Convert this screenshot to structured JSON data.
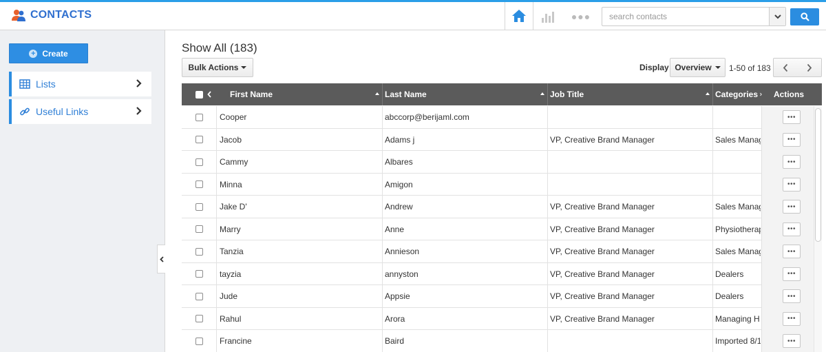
{
  "app": {
    "title": "CONTACTS"
  },
  "search": {
    "placeholder": "search contacts"
  },
  "sidebar": {
    "create_label": "Create",
    "items": [
      {
        "label": "Lists",
        "icon": "table-icon"
      },
      {
        "label": "Useful Links",
        "icon": "link-icon"
      }
    ]
  },
  "main": {
    "title": "Show All (183)",
    "bulk_actions_label": "Bulk Actions",
    "display_label": "Display",
    "display_value": "Overview",
    "page_range": "1-50 of 183"
  },
  "table": {
    "columns": [
      "First Name",
      "Last Name",
      "Job Title",
      "Categories",
      "Actions"
    ],
    "rows": [
      {
        "first": "Cooper",
        "last": "abccorp@berijaml.com",
        "job": "",
        "category": ""
      },
      {
        "first": "Jacob",
        "last": "Adams j",
        "job": "VP, Creative Brand Manager",
        "category": "Sales Manag"
      },
      {
        "first": "Cammy",
        "last": "Albares",
        "job": "",
        "category": ""
      },
      {
        "first": "Minna",
        "last": "Amigon",
        "job": "",
        "category": ""
      },
      {
        "first": "Jake D'",
        "last": "Andrew",
        "job": "VP, Creative Brand Manager",
        "category": "Sales Manag"
      },
      {
        "first": "Marry",
        "last": "Anne",
        "job": "VP, Creative Brand Manager",
        "category": "Physiotherap"
      },
      {
        "first": "Tanzia",
        "last": "Annieson",
        "job": "VP, Creative Brand Manager",
        "category": "Sales Manag"
      },
      {
        "first": "tayzia",
        "last": "annyston",
        "job": "VP, Creative Brand Manager",
        "category": "Dealers"
      },
      {
        "first": "Jude",
        "last": "Appsie",
        "job": "VP, Creative Brand Manager",
        "category": "Dealers"
      },
      {
        "first": "Rahul",
        "last": "Arora",
        "job": "VP, Creative Brand Manager",
        "category": "Managing H"
      },
      {
        "first": "Francine",
        "last": "Baird",
        "job": "",
        "category": "Imported 8/1"
      }
    ],
    "action_glyph": "•••"
  },
  "colors": {
    "accent": "#2b8de0",
    "brand": "#2f6fcf",
    "header_bg": "#5b5b5b",
    "sidebar_bg": "#eef0f3"
  }
}
